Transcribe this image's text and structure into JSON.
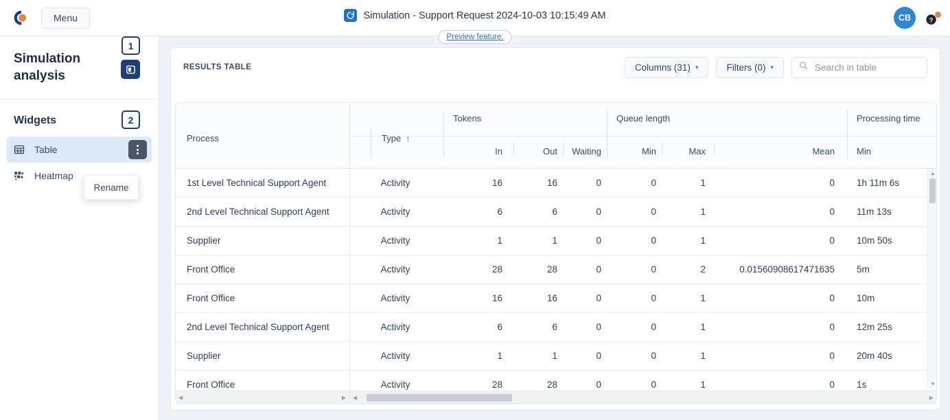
{
  "topbar": {
    "logo_name": "camunda-logo",
    "menu_label": "Menu",
    "title": "Simulation - Support Request 2024-10-03 10:15:49 AM",
    "title_icon": "simulation-refresh-icon",
    "avatar_initials": "CB",
    "help_icon": "help-question-icon"
  },
  "preview": {
    "label": "Preview feature."
  },
  "sidebar": {
    "title": "Simulation analysis",
    "badge_1": "1",
    "panel_toggle_icon": "side-panel-toggle-icon",
    "widgets_title": "Widgets",
    "badge_2": "2",
    "items": [
      {
        "label": "Table",
        "icon": "table-icon",
        "active": true
      },
      {
        "label": "Heatmap",
        "icon": "heatmap-icon",
        "active": false
      }
    ],
    "context_menu": {
      "rename_label": "Rename"
    }
  },
  "toolbar": {
    "results_label": "RESULTS TABLE",
    "columns_label": "Columns (31)",
    "filters_label": "Filters (0)",
    "search_placeholder": "Search in table",
    "search_value": ""
  },
  "table": {
    "groups": [
      {
        "label": "Tokens"
      },
      {
        "label": "Queue length"
      },
      {
        "label": "Processing time"
      }
    ],
    "columns": [
      {
        "key": "process",
        "label": "Process",
        "sort": ""
      },
      {
        "key": "type",
        "label": "Type",
        "sort": "asc"
      },
      {
        "key": "tokens_in",
        "label": "In"
      },
      {
        "key": "tokens_out",
        "label": "Out"
      },
      {
        "key": "tokens_waiting",
        "label": "Waiting"
      },
      {
        "key": "queue_min",
        "label": "Min"
      },
      {
        "key": "queue_max",
        "label": "Max"
      },
      {
        "key": "queue_mean",
        "label": "Mean"
      },
      {
        "key": "proc_min",
        "label": "Min"
      }
    ],
    "rows": [
      {
        "process": "1st Level Technical Support Agent",
        "type": "Activity",
        "tokens_in": "16",
        "tokens_out": "16",
        "tokens_waiting": "0",
        "queue_min": "0",
        "queue_max": "1",
        "queue_mean": "0",
        "proc_min": "1h 11m 6s"
      },
      {
        "process": "2nd Level Technical Support Agent",
        "type": "Activity",
        "tokens_in": "6",
        "tokens_out": "6",
        "tokens_waiting": "0",
        "queue_min": "0",
        "queue_max": "1",
        "queue_mean": "0",
        "proc_min": "11m 13s"
      },
      {
        "process": "Supplier",
        "type": "Activity",
        "tokens_in": "1",
        "tokens_out": "1",
        "tokens_waiting": "0",
        "queue_min": "0",
        "queue_max": "1",
        "queue_mean": "0",
        "proc_min": "10m 50s"
      },
      {
        "process": "Front Office",
        "type": "Activity",
        "tokens_in": "28",
        "tokens_out": "28",
        "tokens_waiting": "0",
        "queue_min": "0",
        "queue_max": "2",
        "queue_mean": "0.01560908617471635",
        "proc_min": "5m"
      },
      {
        "process": "Front Office",
        "type": "Activity",
        "tokens_in": "16",
        "tokens_out": "16",
        "tokens_waiting": "0",
        "queue_min": "0",
        "queue_max": "1",
        "queue_mean": "0",
        "proc_min": "10m"
      },
      {
        "process": "2nd Level Technical Support Agent",
        "type": "Activity",
        "tokens_in": "6",
        "tokens_out": "6",
        "tokens_waiting": "0",
        "queue_min": "0",
        "queue_max": "1",
        "queue_mean": "0",
        "proc_min": "12m 25s"
      },
      {
        "process": "Supplier",
        "type": "Activity",
        "tokens_in": "1",
        "tokens_out": "1",
        "tokens_waiting": "0",
        "queue_min": "0",
        "queue_max": "1",
        "queue_mean": "0",
        "proc_min": "20m 40s"
      },
      {
        "process": "Front Office",
        "type": "Activity",
        "tokens_in": "28",
        "tokens_out": "28",
        "tokens_waiting": "0",
        "queue_min": "0",
        "queue_max": "1",
        "queue_mean": "0",
        "proc_min": "1s"
      }
    ]
  },
  "colors": {
    "accent": "#1f3d77",
    "brand_orange": "#d98a43",
    "link_blue": "#2f6fbf",
    "avatar_blue": "#2f86d4",
    "active_row": "#dbe9f8"
  }
}
